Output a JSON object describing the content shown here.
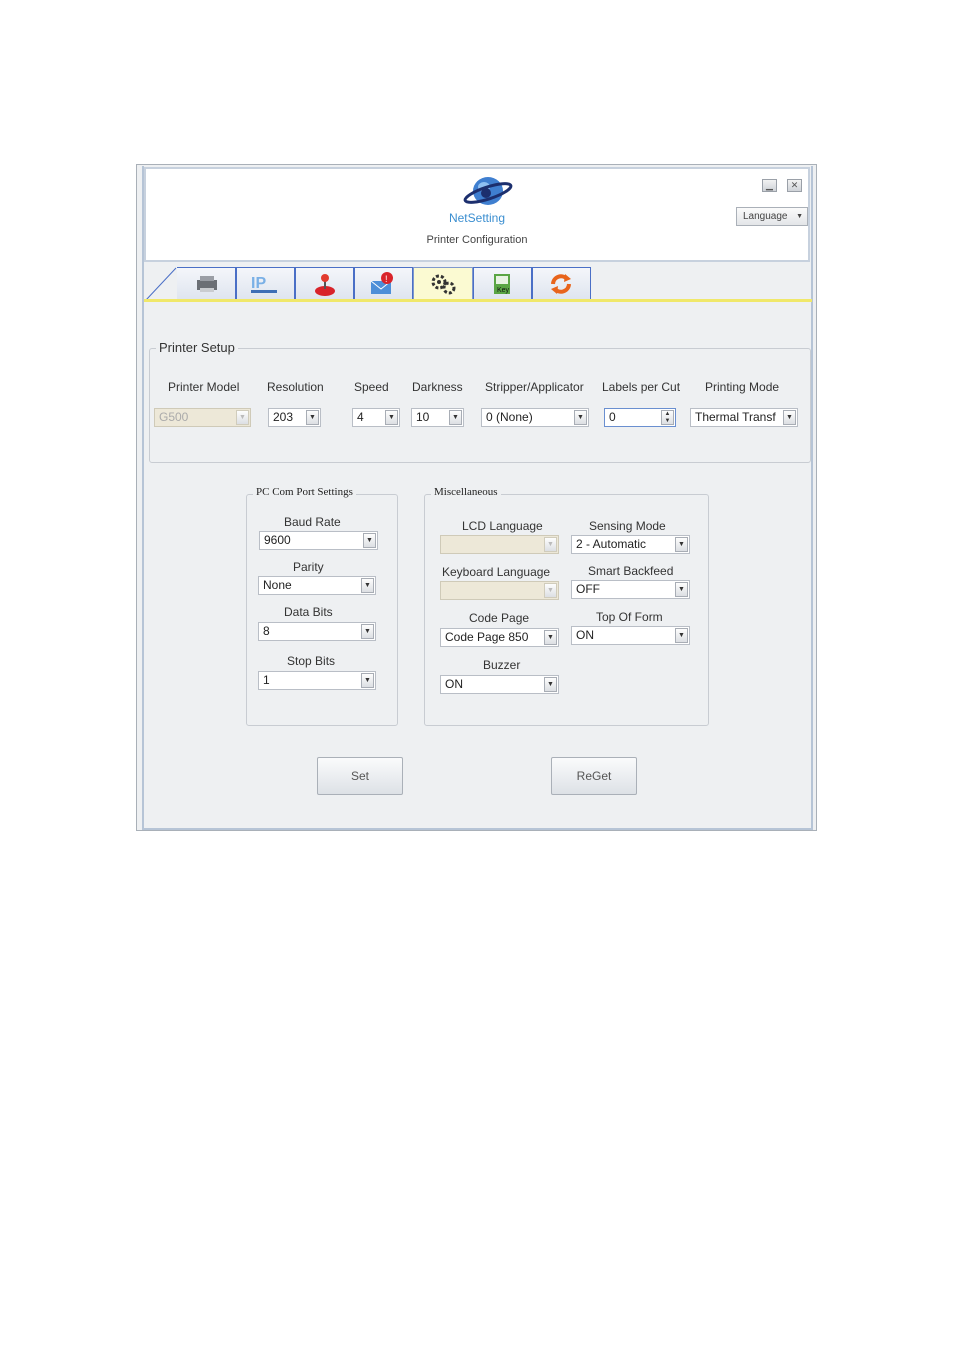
{
  "header": {
    "logo_text": "NetSetting",
    "subtitle": "Printer Configuration",
    "language_label": "Language"
  },
  "tabs": [
    {
      "icon": "printer-icon"
    },
    {
      "icon": "ip-network-icon"
    },
    {
      "icon": "joystick-icon"
    },
    {
      "icon": "mail-alert-icon"
    },
    {
      "icon": "gears-icon",
      "active": true
    },
    {
      "icon": "key-file-icon"
    },
    {
      "icon": "refresh-icon"
    }
  ],
  "printer_setup": {
    "title": "Printer Setup",
    "fields": [
      {
        "label": "Printer Model",
        "value": "G500",
        "disabled": true
      },
      {
        "label": "Resolution",
        "value": "203"
      },
      {
        "label": "Speed",
        "value": "4"
      },
      {
        "label": "Darkness",
        "value": "10"
      },
      {
        "label": "Stripper/Applicator",
        "value": "0 (None)"
      },
      {
        "label": "Labels per Cut",
        "value": "0"
      },
      {
        "label": "Printing Mode",
        "value": "Thermal Transf"
      }
    ]
  },
  "com_port": {
    "title": "PC Com Port Settings",
    "fields": [
      {
        "label": "Baud Rate",
        "value": "9600"
      },
      {
        "label": "Parity",
        "value": "None"
      },
      {
        "label": "Data Bits",
        "value": "8"
      },
      {
        "label": "Stop Bits",
        "value": "1"
      }
    ]
  },
  "misc": {
    "title": "Miscellaneous",
    "fields": [
      {
        "label": "LCD Language",
        "value": "",
        "disabled": true
      },
      {
        "label": "Sensing Mode",
        "value": "2 - Automatic"
      },
      {
        "label": "Keyboard Language",
        "value": "",
        "disabled": true
      },
      {
        "label": "Smart Backfeed",
        "value": "OFF"
      },
      {
        "label": "Code Page",
        "value": "Code Page 850"
      },
      {
        "label": "Top Of Form",
        "value": "ON"
      },
      {
        "label": "Buzzer",
        "value": "ON"
      }
    ]
  },
  "buttons": {
    "set": "Set",
    "reget": "ReGet"
  },
  "colors": {
    "tab_border": "#4a6fc6",
    "active_tab": "#fbfad2",
    "tab_strip": "#f0e86a"
  }
}
